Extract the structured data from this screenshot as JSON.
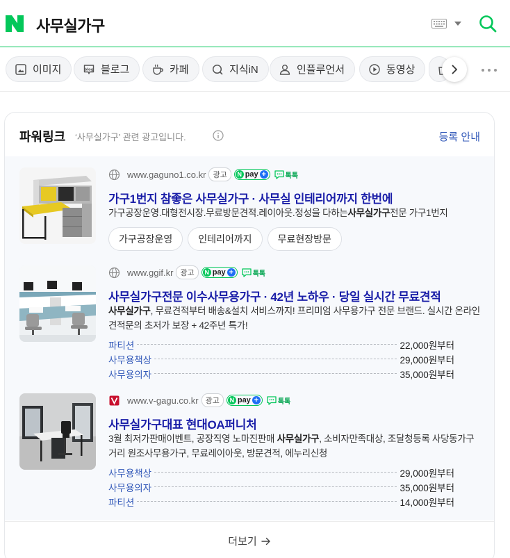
{
  "header": {
    "logo_letter": "N",
    "query": "사무실가구"
  },
  "tabs": [
    {
      "label": "이미지",
      "icon": "image-icon"
    },
    {
      "label": "블로그",
      "icon": "blog-icon"
    },
    {
      "label": "카페",
      "icon": "cafe-icon"
    },
    {
      "label": "지식iN",
      "icon": "kin-icon"
    },
    {
      "label": "인플루언서",
      "icon": "person-icon"
    },
    {
      "label": "동영상",
      "icon": "play-icon"
    }
  ],
  "power_link": {
    "title": "파워링크",
    "subtitle": "‘사무실가구’ 관련 광고입니다.",
    "register_guide": "등록 안내",
    "more": "더보기"
  },
  "badges": {
    "ad": "광고",
    "npay_n": "N",
    "npay_text": "pay",
    "npay_plus": "+",
    "talk": "톡톡"
  },
  "ads": [
    {
      "url": "www.gaguno1.co.kr",
      "title": "가구1번지 참좋은 사무실가구 · 사무실 인테리어까지 한번에",
      "desc_pre": "가구공장운영.대형전시장.무료방문견적.레이아웃.정성을 다하는",
      "desc_bold": "사무실가구",
      "desc_post": "전문 가구1번지",
      "chips": [
        "가구공장운영",
        "인테리어까지",
        "무료현장방문"
      ],
      "prices": []
    },
    {
      "url": "www.ggif.kr",
      "title": "사무실가구전문 이수사무용가구 · 42년 노하우 · 당일 실시간 무료견적",
      "desc_pre": "",
      "desc_bold": "사무실가구",
      "desc_post": ", 무료견적부터 배송&설치 서비스까지! 프리미엄 사무용가구 전문 브랜드. 실시간 온라인 견적문의 초저가 보장 + 42주년 특가!",
      "chips": [],
      "prices": [
        {
          "name": "파티션",
          "value": "22,000원부터"
        },
        {
          "name": "사무용책상",
          "value": "29,000원부터"
        },
        {
          "name": "사무용의자",
          "value": "35,000원부터"
        }
      ]
    },
    {
      "url": "www.v-gagu.co.kr",
      "title": "사무실가구대표 현대OA퍼니처",
      "desc_pre": "3월 최저가판매이벤트, 공장직영 노마진판매 ",
      "desc_bold": "사무실가구",
      "desc_post": ", 소비자만족대상, 조달청등록 사당동가구거리 원조사무용가구, 무료레이아웃, 방문견적, 에누리신청",
      "chips": [],
      "prices": [
        {
          "name": "사무용책상",
          "value": "29,000원부터"
        },
        {
          "name": "사무용의자",
          "value": "35,000원부터"
        },
        {
          "name": "파티션",
          "value": "14,000원부터"
        }
      ]
    }
  ],
  "colors": {
    "naver_green": "#03c75a",
    "title_blue": "#1a1ea8",
    "link_blue": "#3057b8"
  }
}
